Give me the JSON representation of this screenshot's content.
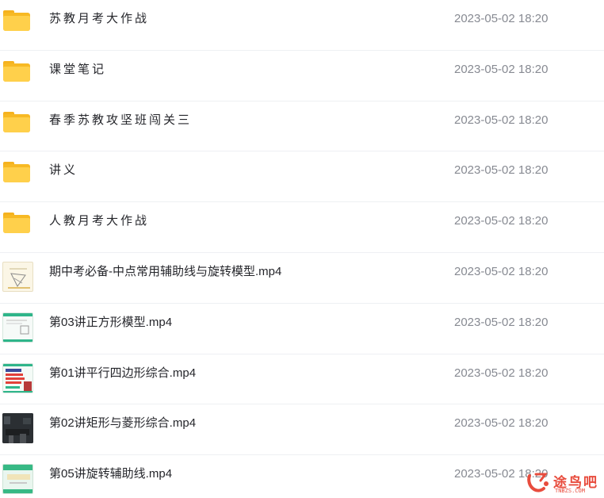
{
  "files": [
    {
      "type": "folder",
      "name": "苏教月考大作战",
      "modified": "2023-05-02 18:20"
    },
    {
      "type": "folder",
      "name": "课堂笔记",
      "modified": "2023-05-02 18:20"
    },
    {
      "type": "folder",
      "name": "春季苏教攻坚班闯关三",
      "modified": "2023-05-02 18:20"
    },
    {
      "type": "folder",
      "name": "讲义",
      "modified": "2023-05-02 18:20"
    },
    {
      "type": "folder",
      "name": "人教月考大作战",
      "modified": "2023-05-02 18:20"
    },
    {
      "type": "video",
      "name": "期中考必备-中点常用辅助线与旋转模型.mp4",
      "modified": "2023-05-02 18:20"
    },
    {
      "type": "video",
      "name": "第03讲正方形模型.mp4",
      "modified": "2023-05-02 18:20"
    },
    {
      "type": "video",
      "name": "第01讲平行四边形综合.mp4",
      "modified": "2023-05-02 18:20"
    },
    {
      "type": "video",
      "name": "第02讲矩形与菱形综合.mp4",
      "modified": "2023-05-02 18:20"
    },
    {
      "type": "video",
      "name": "第05讲旋转辅助线.mp4",
      "modified": "2023-05-02 18:20"
    }
  ],
  "watermark": {
    "text": "途鸟吧",
    "subtext": "TNBZS.COM",
    "icon": "tunba-logo"
  },
  "colors": {
    "folder": "#ffd04b",
    "text": "#25262b",
    "time": "#878a92",
    "watermark": "#e84c3d"
  }
}
